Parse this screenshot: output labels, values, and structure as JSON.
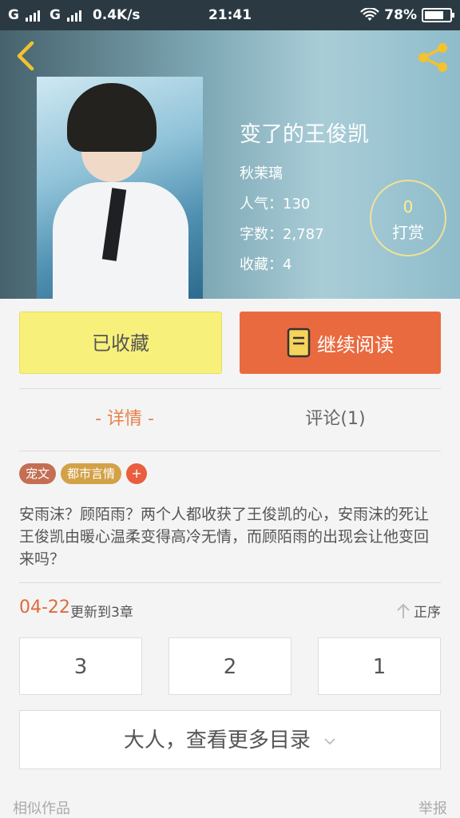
{
  "status_bar": {
    "carrier_1": "G",
    "carrier_2": "G",
    "net_speed": "0.4K/s",
    "time": "21:41",
    "battery_percent": "78%",
    "battery_level": 0.78
  },
  "book": {
    "title": "变了的王俊凯",
    "author": "秋茉璃",
    "stats": [
      {
        "label": "人气：",
        "value": "130"
      },
      {
        "label": "字数：",
        "value": "2,787"
      },
      {
        "label": "收藏：",
        "value": "4"
      }
    ],
    "reward": {
      "count": "0",
      "label": "打赏"
    }
  },
  "actions": {
    "collect_label": "已收藏",
    "read_label": "继续阅读"
  },
  "tabs": {
    "detail": "- 详情 -",
    "comments": "评论(1)"
  },
  "tags": [
    "宠文",
    "都市言情",
    "+"
  ],
  "summary": "安雨沫？顾陌雨？两个人都收获了王俊凯的心，安雨沫的死让王俊凯由暖心温柔变得高冷无情，而顾陌雨的出现会让他变回来吗？",
  "update": {
    "date": "04-22",
    "text": "更新到3章",
    "sort_label": "正序"
  },
  "chapters": [
    "3",
    "2",
    "1"
  ],
  "more_catalog": "大人，查看更多目录",
  "footer": {
    "similar": "相似作品",
    "report": "举报"
  },
  "colors": {
    "accent_orange": "#ea6a3f",
    "collect_yellow": "#f7f17c",
    "tab_active": "#e8804a"
  }
}
